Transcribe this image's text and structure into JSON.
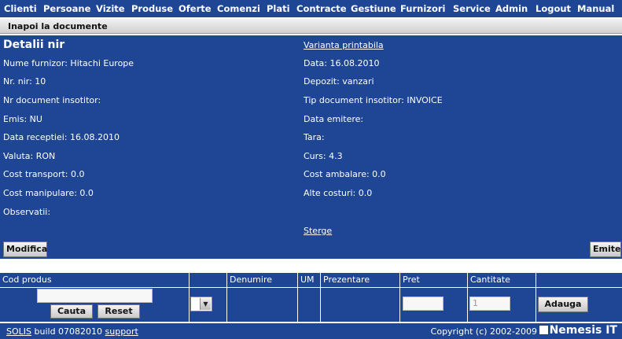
{
  "nav": {
    "items": [
      "Clienti",
      "Persoane",
      "Vizite",
      "Produse",
      "Oferte",
      "Comenzi",
      "Plati",
      "Contracte",
      "Gestiune",
      "Furnizori",
      "Service",
      "Admin",
      "Logout",
      "Manual"
    ]
  },
  "subbar": {
    "back_label": "Inapoi la documente"
  },
  "panel": {
    "title": "Detalii nir",
    "printable_link": "Varianta printabila",
    "supplier": "Nume furnizor: Hitachi Europe",
    "nir_no": "Nr. nir: 10",
    "doc_no": "Nr document insotitor:",
    "emis": "Emis: NU",
    "receipt_date": "Data receptiei: 16.08.2010",
    "currency": "Valuta: RON",
    "transport_cost": "Cost transport: 0.0",
    "handling_cost": "Cost manipulare: 0.0",
    "notes": "Observatii:",
    "date": "Data: 16.08.2010",
    "warehouse": "Depozit: vanzari",
    "doc_type": "Tip document insotitor: INVOICE",
    "issue_date": "Data emitere:",
    "country": "Tara:",
    "rate": "Curs: 4.3",
    "packaging_cost": "Cost ambalare: 0.0",
    "other_costs": "Alte costuri: 0.0",
    "delete_link": "Sterge",
    "modify_label": "Modifica",
    "emit_label": "Emite"
  },
  "grid": {
    "headers": [
      "Cod produs",
      "",
      "Denumire",
      "UM",
      "Prezentare",
      "Pret",
      "Cantitate",
      ""
    ],
    "search_label": "Cauta",
    "reset_label": "Reset",
    "quantity_placeholder": "1",
    "add_label": "Adauga"
  },
  "footer": {
    "product": "SOLIS",
    "build": "build 07082010",
    "support": "support",
    "copyright": "Copyright (c) 2002-2009",
    "brand": "Nemesis IT"
  }
}
